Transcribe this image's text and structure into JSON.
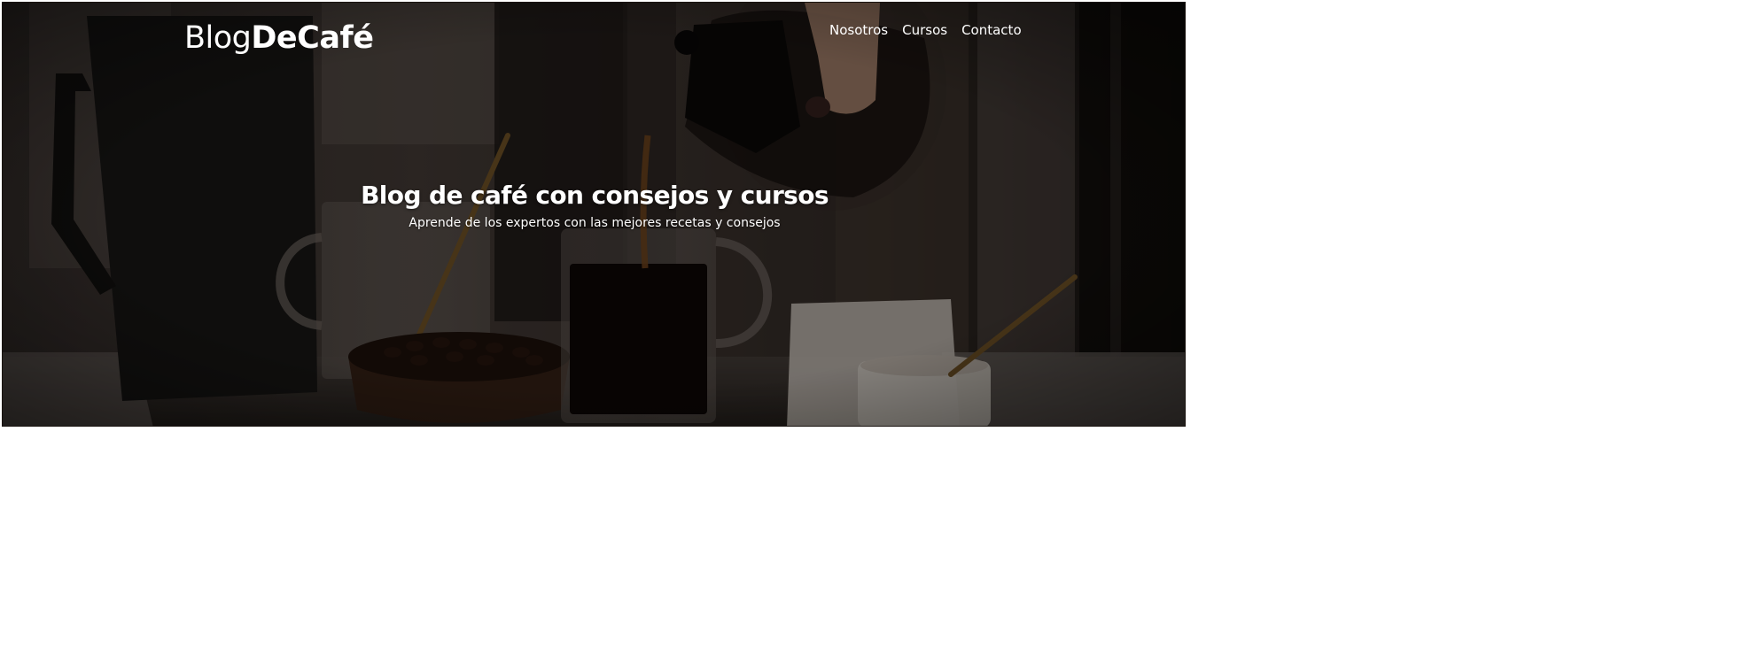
{
  "header": {
    "logo": {
      "light_part": "Blog",
      "bold_part": "DeCafé"
    },
    "nav": [
      {
        "label": "Nosotros"
      },
      {
        "label": "Cursos"
      },
      {
        "label": "Contacto"
      }
    ]
  },
  "hero": {
    "title": "Blog de café con consejos y cursos",
    "subtitle": "Aprende de los expertos con las mejores recetas y consejos",
    "overlay_color": "#000000",
    "image_description_icon": "coffee-pour-photo"
  },
  "colors": {
    "text": "#ffffff",
    "page_background": "#ffffff"
  }
}
